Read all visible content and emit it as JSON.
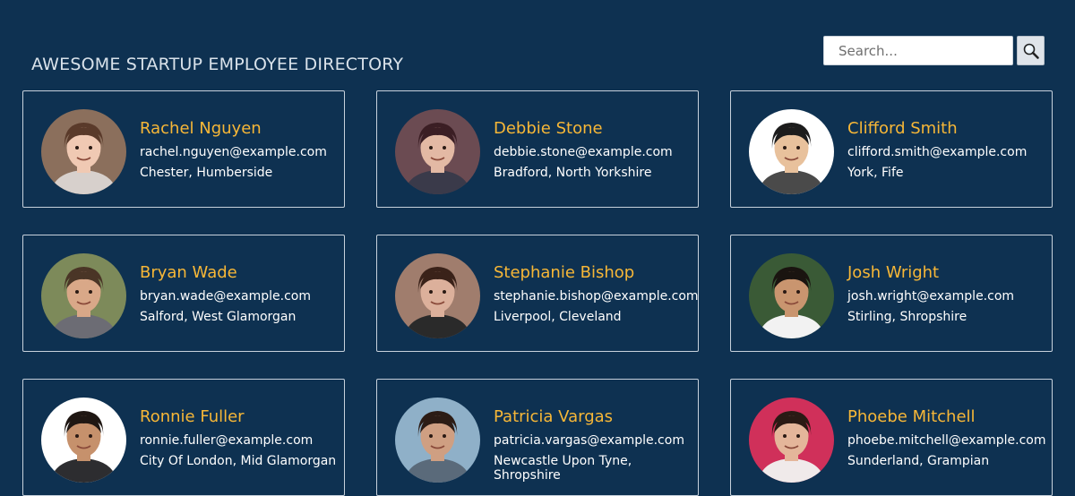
{
  "header": {
    "title": "AWESOME STARTUP EMPLOYEE DIRECTORY"
  },
  "search": {
    "placeholder": "Search...",
    "value": "",
    "button_icon": "search-icon"
  },
  "colors": {
    "background": "#0e3151",
    "name_accent": "#f7b737",
    "card_border": "#c7d1dc"
  },
  "employees": [
    {
      "name": "Rachel Nguyen",
      "email": "rachel.nguyen@example.com",
      "location": "Chester, Humberside",
      "avatar": {
        "bg": "#8b6f5c",
        "skin": "#f0c9b3",
        "hair": "#5a3a2a",
        "shirt": "#d7d0cc"
      }
    },
    {
      "name": "Debbie Stone",
      "email": "debbie.stone@example.com",
      "location": "Bradford, North Yorkshire",
      "avatar": {
        "bg": "#6b4b52",
        "skin": "#e3b9a4",
        "hair": "#3b1e24",
        "shirt": "#3a3a4a"
      }
    },
    {
      "name": "Clifford Smith",
      "email": "clifford.smith@example.com",
      "location": "York, Fife",
      "avatar": {
        "bg": "#ffffff",
        "skin": "#e8c19c",
        "hair": "#1c1c1c",
        "shirt": "#4a4a4a"
      }
    },
    {
      "name": "Bryan Wade",
      "email": "bryan.wade@example.com",
      "location": "Salford, West Glamorgan",
      "avatar": {
        "bg": "#7d8a5a",
        "skin": "#d9a888",
        "hair": "#4a3526",
        "shirt": "#6c6c74"
      }
    },
    {
      "name": "Stephanie Bishop",
      "email": "stephanie.bishop@example.com",
      "location": "Liverpool, Cleveland",
      "avatar": {
        "bg": "#a07d6d",
        "skin": "#dcb09b",
        "hair": "#3a2219",
        "shirt": "#2a2a2a"
      }
    },
    {
      "name": "Josh Wright",
      "email": "josh.wright@example.com",
      "location": "Stirling, Shropshire",
      "avatar": {
        "bg": "#3a5a36",
        "skin": "#c9956f",
        "hair": "#1a1410",
        "shirt": "#f2f2f2"
      }
    },
    {
      "name": "Ronnie Fuller",
      "email": "ronnie.fuller@example.com",
      "location": "City Of London, Mid Glamorgan",
      "avatar": {
        "bg": "#ffffff",
        "skin": "#c6916c",
        "hair": "#1f1713",
        "shirt": "#2d2d30"
      }
    },
    {
      "name": "Patricia Vargas",
      "email": "patricia.vargas@example.com",
      "location": "Newcastle Upon Tyne, Shropshire",
      "avatar": {
        "bg": "#8fb0c8",
        "skin": "#cf9f82",
        "hair": "#2c1c15",
        "shirt": "#5a6a7a"
      }
    },
    {
      "name": "Phoebe Mitchell",
      "email": "phoebe.mitchell@example.com",
      "location": "Sunderland, Grampian",
      "avatar": {
        "bg": "#d0305a",
        "skin": "#e4b69a",
        "hair": "#2a1a14",
        "shirt": "#f0eaea"
      }
    }
  ]
}
